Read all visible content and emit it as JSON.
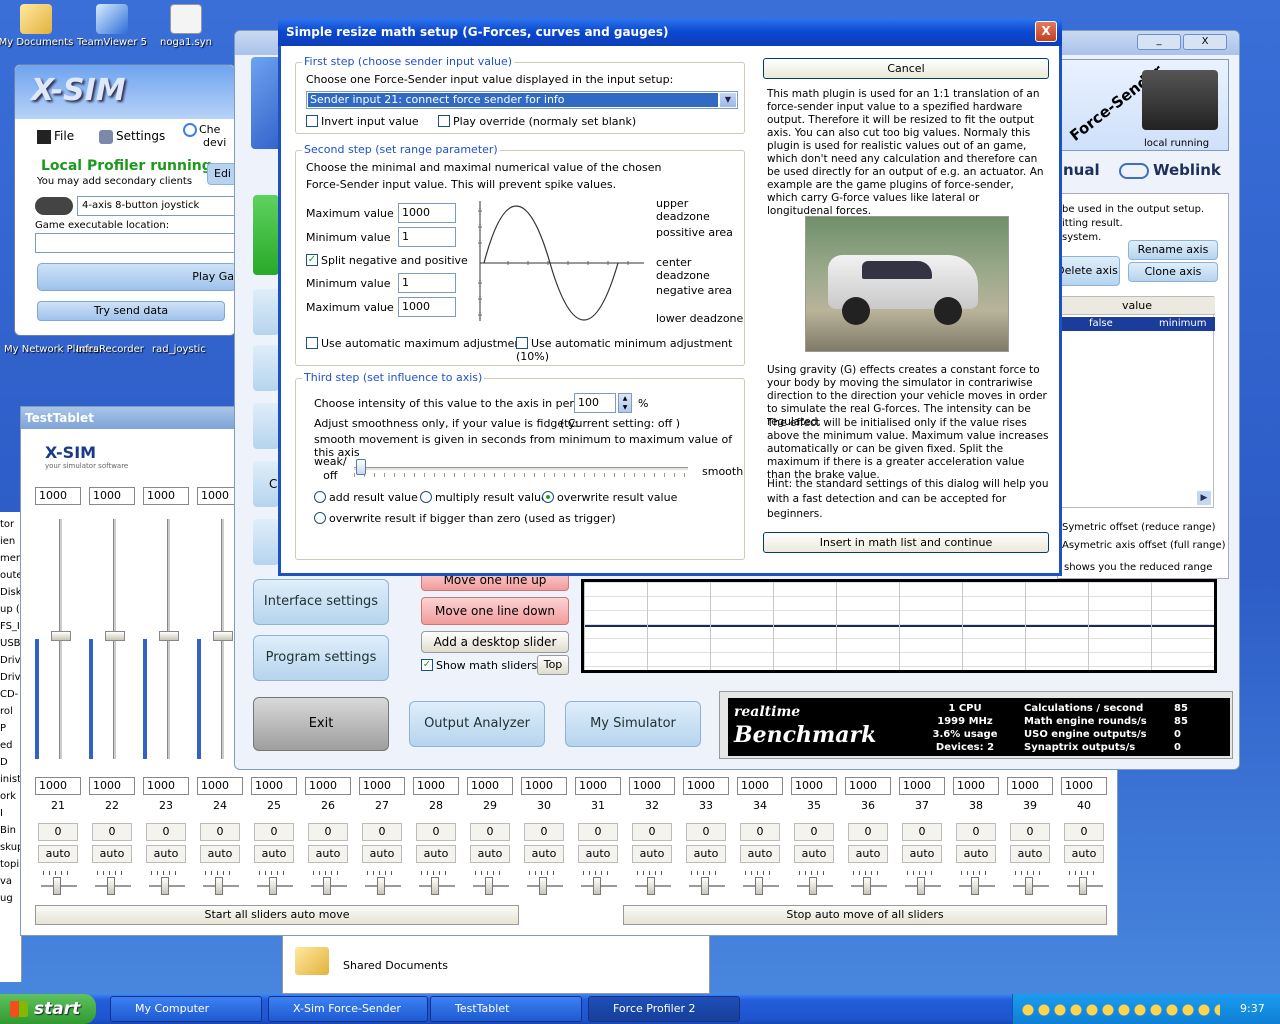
{
  "desktop": {
    "icons": [
      "My Documents",
      "TeamViewer 5",
      "noga1.syn"
    ],
    "icons_low": [
      "My Network Places",
      "InfraRecorder",
      "rad_joystic"
    ],
    "shared": "Shared Documents"
  },
  "profiler": {
    "menu_file": "File",
    "menu_settings": "Settings",
    "menu_check": "Che",
    "menu_check2": "devi",
    "status": "Local Profiler running",
    "hint": "You may add secondary clients",
    "edit": "Edi",
    "joystick": "4-axis 8-button joystick",
    "exe_label": "Game executable location:",
    "play": "Play Ga",
    "try": "Try send data",
    "logo": "X-SIM"
  },
  "tablet": {
    "title": "TestTablet",
    "logo": "X-SIM",
    "slogan": "your simulator software",
    "top_vals": [
      "1000",
      "1000",
      "1000",
      "1000"
    ],
    "channels": [
      "21",
      "22",
      "23",
      "24",
      "25",
      "26",
      "27",
      "28",
      "29",
      "30",
      "31",
      "32",
      "33",
      "34",
      "35",
      "36",
      "37",
      "38",
      "39",
      "40"
    ],
    "values": [
      "1000",
      "1000",
      "1000",
      "1000",
      "1000",
      "1000",
      "1000",
      "1000",
      "1000",
      "1000",
      "1000",
      "1000",
      "1000",
      "1000",
      "1000",
      "1000",
      "1000",
      "1000",
      "1000",
      "1000"
    ],
    "zero": "0",
    "auto": "auto",
    "start_all": "Start all sliders auto move",
    "stop_all": "Stop auto move of all sliders"
  },
  "sender": {
    "title_btns": [
      "_",
      "X"
    ],
    "brand": "Force-Sender",
    "local_running": "local running",
    "manual": "nual",
    "weblink": "Weblink",
    "side_text": [
      "be used in the output setup.",
      "itting result.",
      "system."
    ],
    "rename": "Rename axis",
    "delete": "Delete axis",
    "clone": "Clone axis",
    "col_value": "value",
    "row_false": "false",
    "row_minimum": "minimum",
    "sym_offset": "Symetric offset (reduce range)",
    "asym_offset": "Asymetric axis offset (full range)",
    "reduced": "shows you the reduced range",
    "move_up": "Move one line up",
    "move_down": "Move one line down",
    "add_slider": "Add a desktop slider",
    "show_math": "Show math sliders",
    "top": "Top",
    "interface": "Interface settings",
    "program": "Program settings",
    "exit": "Exit",
    "analyzer": "Output Analyzer",
    "simulator": "My Simulator",
    "left_c": "C"
  },
  "bench": {
    "l1": "realtime",
    "l2": "Benchmark",
    "cpu": "1 CPU",
    "mhz": "1999 MHz",
    "usage": "3.6% usage",
    "devices": "Devices: 2",
    "rows": [
      {
        "label": "Calculations / second",
        "val": "85"
      },
      {
        "label": "Math engine rounds/s",
        "val": "85"
      },
      {
        "label": "USO engine outputs/s",
        "val": "0"
      },
      {
        "label": "Synaptrix outputs/s",
        "val": "0"
      }
    ]
  },
  "dialog": {
    "title": "Simple resize math setup (G-Forces, curves and gauges)",
    "close": "X",
    "s1": {
      "legend": "First step (choose sender input value)",
      "prompt": "Choose one Force-Sender input value displayed in the input setup:",
      "selected": "Sender input 21: connect force sender for info",
      "invert": "Invert input value",
      "override": "Play override (normaly set blank)"
    },
    "s2": {
      "legend": "Second step (set range parameter)",
      "desc1": "Choose the minimal and maximal numerical value of the chosen",
      "desc2": "Force-Sender input value. This will prevent spike values.",
      "max_label": "Maximum value",
      "max_val": "1000",
      "min_label": "Minimum value",
      "min_val": "1",
      "split": "Split negative and positive",
      "min2_label": "Minimum value",
      "min2_val": "1",
      "max2_label": "Maximum value",
      "max2_val": "1000",
      "dash": "-",
      "zones": [
        "upper deadzone",
        "possitive area",
        "center deadzone",
        "negative area",
        "lower deadzone"
      ],
      "auto_max": "Use automatic maximum adjustment",
      "auto_min": "Use automatic minimum adjustment (10%)"
    },
    "s3": {
      "legend": "Third step (set influence to axis)",
      "intensity_label": "Choose intensity of this value to the axis in percent:",
      "intensity": "100",
      "pct": "%",
      "smooth1": "Adjust smoothness only, if your value is fidgety:",
      "current": "( Current setting: off )",
      "smooth2": "smooth movement is given in seconds from minimum to maximum value of this axis",
      "weak": "weak/",
      "off": "off",
      "smooth": "smooth",
      "add": "add result value",
      "multiply": "multiply result value",
      "overwrite": "overwrite result value",
      "overwrite_big": "overwrite result if bigger than zero (used as trigger)"
    },
    "cancel": "Cancel",
    "info": "This math plugin is used for an 1:1 translation of an force-sender input value to a spezified hardware output. Therefore it will be resized to fit the output axis. You can also cut too big values. Normaly this plugin is used for realistic values out of an game, which don't need any calculation and therefore can be used directly for an output of e.g. an actuator. An example are the game plugins of force-sender, which carry G-force values like lateral or longitudenal forces.",
    "info2": "Using gravity (G) effects creates a constant force to your body by moving the simulator in contrariwise direction to the direction your vehicle moves in order to simulate the real G-forces. The intensity can be regulated.",
    "info3": "The effect will be initialised only if the value rises above the minimum value. Maximum value increases automatically or can be given fixed. Split the maximum if there is a greater acceleration value than the brake value.",
    "hint": "Hint: the standard settings of this dialog will help you with a fast detection and can be accepted for beginners.",
    "insert": "Insert in math list and continue"
  },
  "taskbar": {
    "start": "start",
    "items": [
      "My Computer",
      "X-Sim Force-Sender",
      "TestTablet",
      "Force Profiler 2"
    ],
    "clock": "9:37"
  },
  "left_fragments": [
    "tor",
    "ien",
    "men",
    "outer",
    "Disk",
    "up (",
    "FS_I",
    "USB",
    "Driv",
    "Driv",
    "CD-",
    "rol P",
    "ed D",
    "inistr",
    "ork I",
    "Bin",
    "skup",
    "topi",
    "va",
    "ug"
  ]
}
